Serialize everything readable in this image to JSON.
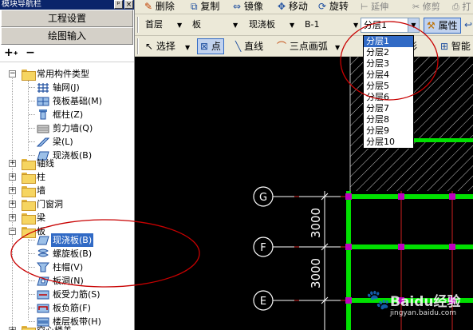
{
  "left_panel": {
    "title": "模块导航栏",
    "engineering_settings_label": "工程设置",
    "drawing_input_label": "绘图输入",
    "tree": {
      "common_types": {
        "label": "常用构件类型",
        "children": [
          "轴网(J)",
          "筏板基础(M)",
          "框柱(Z)",
          "剪力墙(Q)",
          "梁(L)",
          "现浇板(B)"
        ]
      },
      "folders": [
        "轴线",
        "柱",
        "墙",
        "门窗洞",
        "梁",
        "板"
      ],
      "slab_children": [
        "现浇板(B)",
        "螺旋板(B)",
        "柱帽(V)",
        "板洞(N)",
        "板受力筋(S)",
        "板负筋(F)",
        "楼层板带(H)"
      ],
      "last_folder": "空心楼盖"
    }
  },
  "toolbar_top": {
    "delete_label": "删除",
    "copy_label": "复制",
    "mirror_label": "镜像",
    "move_label": "移动",
    "rotate_label": "旋转",
    "extend_label": "延伸",
    "trim_label": "修剪",
    "print_label": "打"
  },
  "toolbar_mid": {
    "floor_value": "首层",
    "category_value": "板",
    "type_value": "现浇板",
    "name_value": "B-1",
    "layer_value": "分层1",
    "properties_label": "属性"
  },
  "toolbar_bottom": {
    "select_label": "选择",
    "point_label": "点",
    "line_label": "直线",
    "arc_label": "三点画弧",
    "rect_label": "矩形",
    "smart_label": "智能"
  },
  "layer_dropdown": {
    "options": [
      "分层1",
      "分层2",
      "分层3",
      "分层4",
      "分层5",
      "分层6",
      "分层7",
      "分层8",
      "分层9",
      "分层10"
    ],
    "selected": "分层1"
  },
  "canvas": {
    "axis_labels": [
      "G",
      "F",
      "E"
    ],
    "dimensions": [
      "3000",
      "3000"
    ]
  },
  "watermark": {
    "text": "Baidu经验",
    "url": "jingyan.baidu.com"
  },
  "colors": {
    "selection": "#316ac5",
    "beam_green": "#00e000",
    "node_magenta": "#c000c0",
    "grid_red": "#d02020",
    "annotation_circle": "#c80000"
  }
}
